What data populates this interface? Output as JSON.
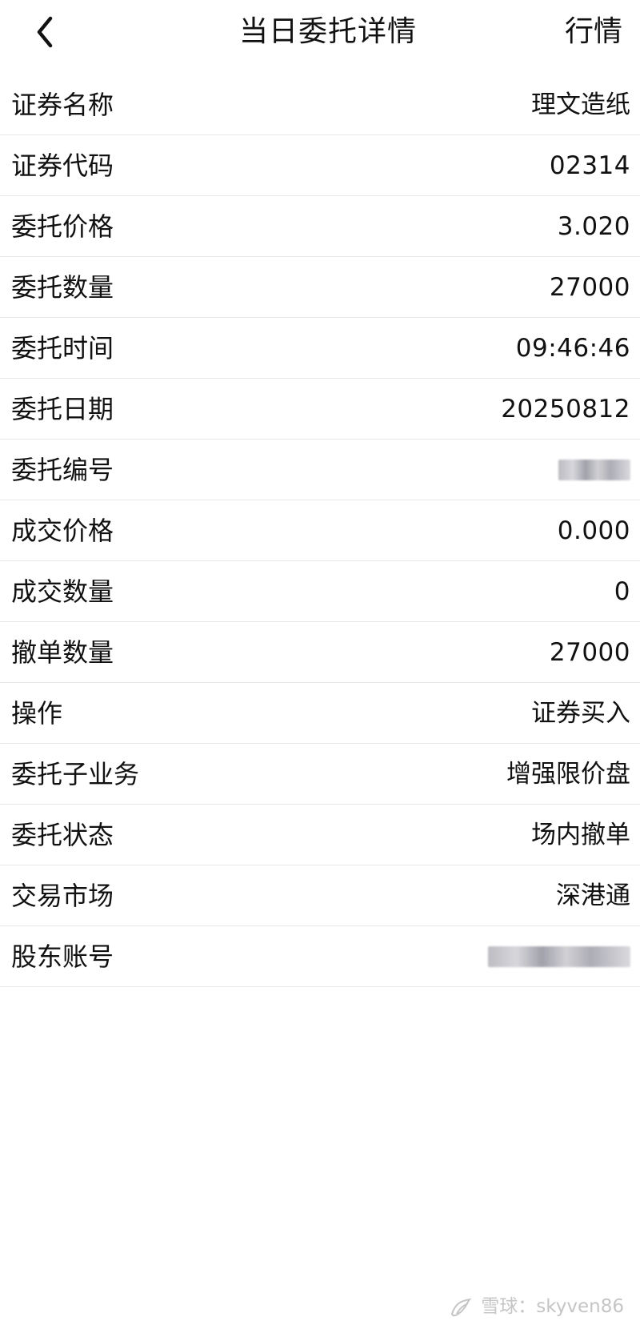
{
  "header": {
    "title": "当日委托详情",
    "market_label": "行情",
    "back_icon": "chevron-left-icon"
  },
  "details": [
    {
      "label": "证券名称",
      "value": "理文造纸"
    },
    {
      "label": "证券代码",
      "value": "02314"
    },
    {
      "label": "委托价格",
      "value": "3.020"
    },
    {
      "label": "委托数量",
      "value": "27000"
    },
    {
      "label": "委托时间",
      "value": "09:46:46"
    },
    {
      "label": "委托日期",
      "value": "20250812"
    },
    {
      "label": "委托编号",
      "value": null
    },
    {
      "label": "成交价格",
      "value": "0.000"
    },
    {
      "label": "成交数量",
      "value": "0"
    },
    {
      "label": "撤单数量",
      "value": "27000"
    },
    {
      "label": "操作",
      "value": "证券买入"
    },
    {
      "label": "委托子业务",
      "value": "增强限价盘"
    },
    {
      "label": "委托状态",
      "value": "场内撤单"
    },
    {
      "label": "交易市场",
      "value": "深港通"
    },
    {
      "label": "股东账号",
      "value": null
    }
  ],
  "watermark": {
    "text": "雪球：skyven86",
    "icon": "snowball-logo-icon"
  },
  "colors": {
    "text": "#111111",
    "divider": "#e7e7e7",
    "watermark": "#c5c5c5",
    "background": "#ffffff"
  }
}
